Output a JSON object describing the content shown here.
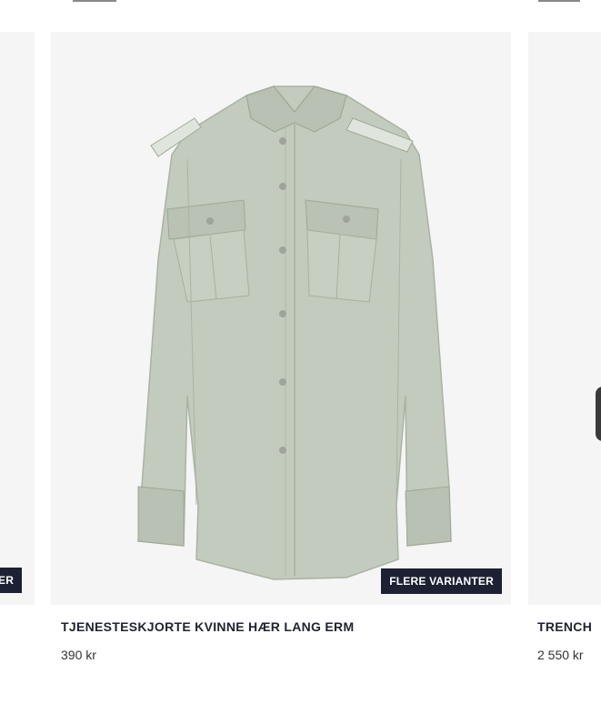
{
  "products": [
    {
      "badge": "ER",
      "title": "",
      "price": ""
    },
    {
      "badge": "FLERE VARIANTER",
      "title": "TJENESTESKJORTE KVINNE HÆR LANG ERM",
      "price": "390 kr",
      "image_icon": "shirt-icon",
      "shirt_color": "#c2cbbd"
    },
    {
      "badge": "",
      "title": "TRENCH",
      "price": "2 550 kr"
    }
  ],
  "colors": {
    "card_background": "#f5f5f5",
    "badge_background": "#1c2233",
    "badge_text": "#ffffff",
    "title_text": "#1f2230"
  }
}
